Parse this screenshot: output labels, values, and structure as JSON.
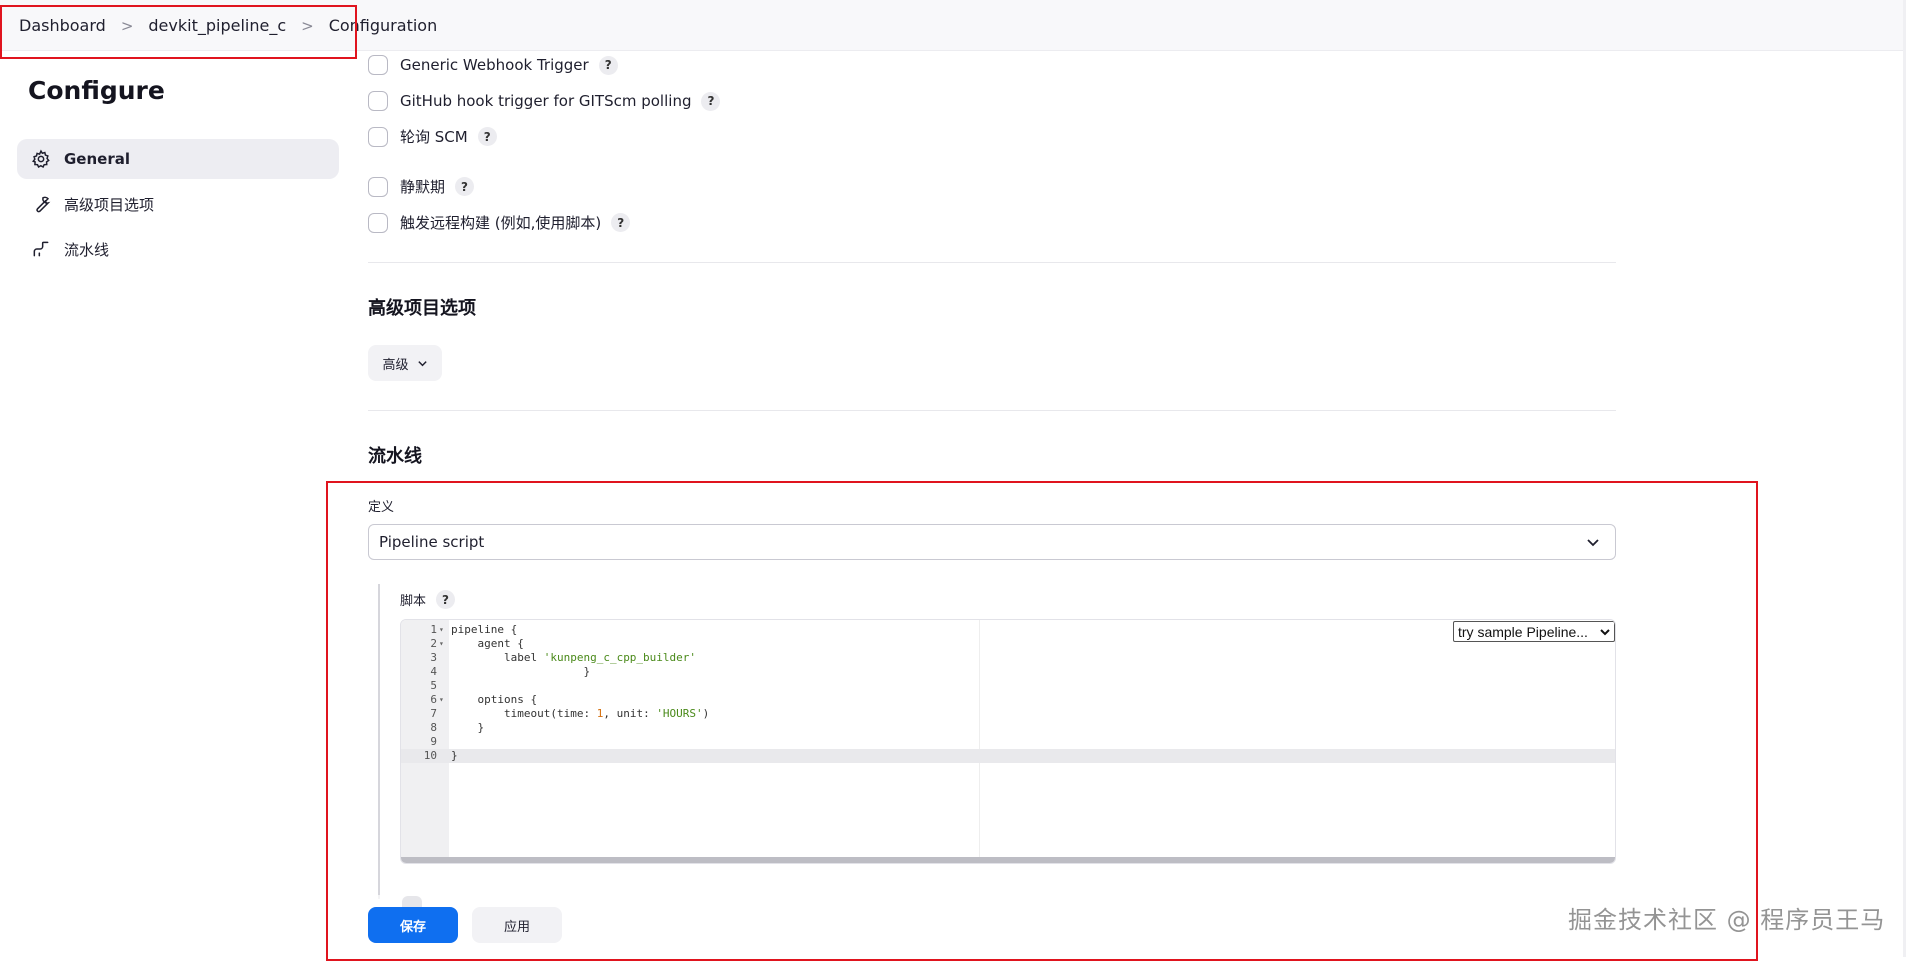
{
  "breadcrumb": {
    "items": [
      "Dashboard",
      "devkit_pipeline_c",
      "Configuration"
    ],
    "separator": ">"
  },
  "sidebar": {
    "title": "Configure",
    "items": [
      {
        "label": "General",
        "icon": "gear-icon",
        "active": true
      },
      {
        "label": "高级项目选项",
        "icon": "wrench-icon",
        "active": false
      },
      {
        "label": "流水线",
        "icon": "pipeline-icon",
        "active": false
      }
    ]
  },
  "triggers": [
    {
      "label": "Generic Webhook Trigger",
      "checked": false
    },
    {
      "label": "GitHub hook trigger for GITScm polling",
      "checked": false
    },
    {
      "label": "轮询 SCM",
      "checked": false
    },
    {
      "label": "静默期",
      "checked": false
    },
    {
      "label": "触发远程构建 (例如,使用脚本)",
      "checked": false
    }
  ],
  "help_symbol": "?",
  "advanced": {
    "title": "高级项目选项",
    "button_label": "高级"
  },
  "pipeline": {
    "title": "流水线",
    "definition_label": "定义",
    "definition_value": "Pipeline script",
    "script_label": "脚本",
    "sample_select": "try sample Pipeline...",
    "lines": [
      {
        "n": "1",
        "fold": true,
        "code": "pipeline {"
      },
      {
        "n": "2",
        "fold": true,
        "code": "    agent {"
      },
      {
        "n": "3",
        "fold": false,
        "code": "        label ",
        "str": "'kunpeng_c_cpp_builder'"
      },
      {
        "n": "4",
        "fold": false,
        "code": "                    }"
      },
      {
        "n": "5",
        "fold": false,
        "code": ""
      },
      {
        "n": "6",
        "fold": true,
        "code": "    options {"
      },
      {
        "n": "7",
        "fold": false,
        "code": "        timeout(time: ",
        "num": "1",
        "after": ", unit: ",
        "str": "'HOURS'",
        "end": ")"
      },
      {
        "n": "8",
        "fold": false,
        "code": "    }"
      },
      {
        "n": "9",
        "fold": false,
        "code": ""
      },
      {
        "n": "10",
        "fold": false,
        "code": "}",
        "active": true
      }
    ]
  },
  "footer": {
    "save_label": "保存",
    "apply_label": "应用"
  },
  "watermark": "掘金技术社区 @ 程序员王马",
  "colors": {
    "primary": "#0f6ff0",
    "annotation": "#e0141e",
    "string": "#4a8a1a",
    "number": "#d4700f"
  }
}
